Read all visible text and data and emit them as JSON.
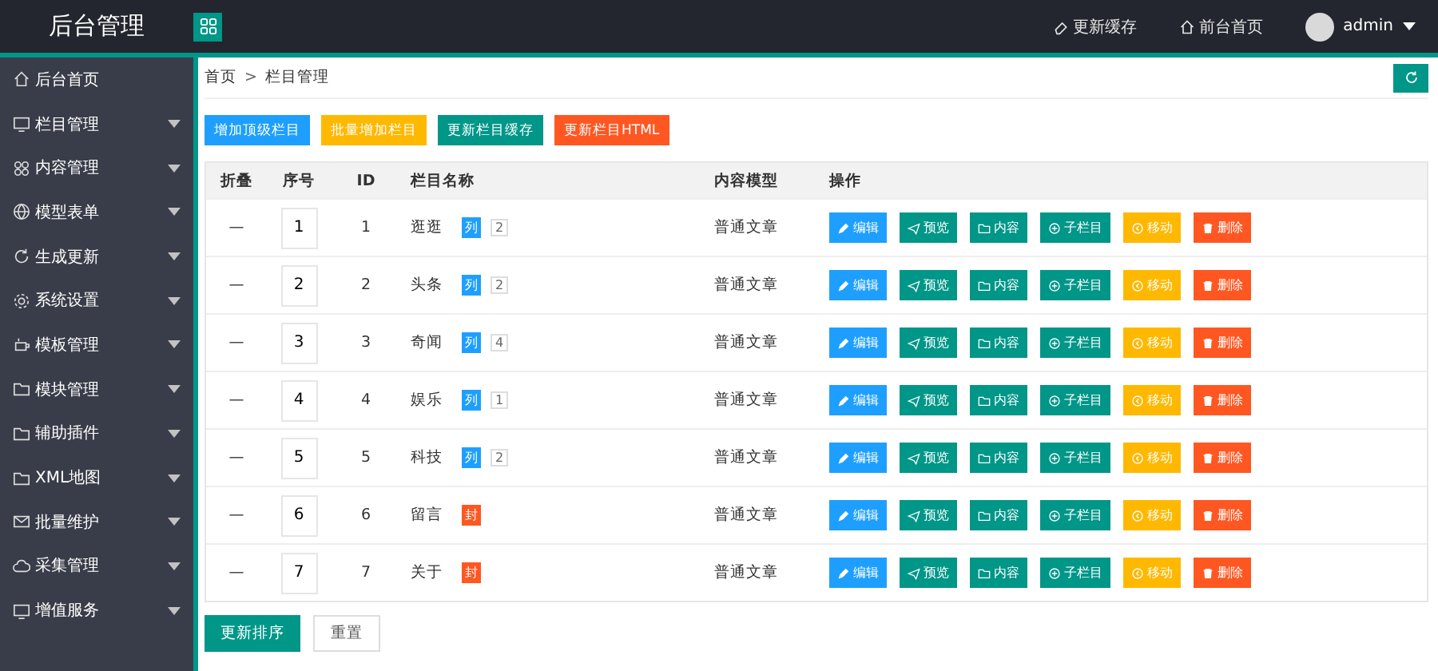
{
  "header": {
    "title": "后台管理",
    "links": [
      {
        "label": "更新缓存",
        "kind": "cache"
      },
      {
        "label": "前台首页",
        "kind": "home"
      }
    ],
    "user": "admin"
  },
  "sidebar": {
    "items": [
      {
        "label": "后台首页",
        "kind": "home",
        "submenu": false
      },
      {
        "label": "栏目管理",
        "kind": "monitor",
        "submenu": true
      },
      {
        "label": "内容管理",
        "kind": "apps",
        "submenu": true
      },
      {
        "label": "模型表单",
        "kind": "globe",
        "submenu": true
      },
      {
        "label": "生成更新",
        "kind": "refresh",
        "submenu": true
      },
      {
        "label": "系统设置",
        "kind": "gear",
        "submenu": true
      },
      {
        "label": "模板管理",
        "kind": "cup",
        "submenu": true
      },
      {
        "label": "模块管理",
        "kind": "folder",
        "submenu": true
      },
      {
        "label": "辅助插件",
        "kind": "folder",
        "submenu": true
      },
      {
        "label": "XML地图",
        "kind": "folder",
        "submenu": true
      },
      {
        "label": "批量维护",
        "kind": "mail",
        "submenu": true
      },
      {
        "label": "采集管理",
        "kind": "cloud",
        "submenu": true
      },
      {
        "label": "增值服务",
        "kind": "monitor",
        "submenu": true
      }
    ]
  },
  "breadcrumb": {
    "items": [
      "首页",
      "栏目管理"
    ],
    "separator": ">"
  },
  "toolbar": [
    {
      "label": "增加顶级栏目",
      "kind": "blue"
    },
    {
      "label": "批量增加栏目",
      "kind": "yellow"
    },
    {
      "label": "更新栏目缓存",
      "kind": "teal"
    },
    {
      "label": "更新栏目HTML",
      "kind": "red"
    }
  ],
  "table": {
    "columns": [
      "折叠",
      "序号",
      "ID",
      "栏目名称",
      "内容模型",
      "操作"
    ],
    "rows": [
      {
        "fold": "—",
        "order": "1",
        "id": "1",
        "name": "逛逛",
        "tag": {
          "text": "列",
          "color": "#1e9fff"
        },
        "count": "2",
        "model": "普通文章",
        "actions": [
          {
            "label": "编辑",
            "kind": "edit"
          },
          {
            "label": "预览",
            "kind": "preview"
          },
          {
            "label": "内容",
            "kind": "content"
          },
          {
            "label": "子栏目",
            "kind": "sub"
          },
          {
            "label": "移动",
            "kind": "move"
          },
          {
            "label": "删除",
            "kind": "delete"
          }
        ]
      },
      {
        "fold": "—",
        "order": "2",
        "id": "2",
        "name": "头条",
        "tag": {
          "text": "列",
          "color": "#1e9fff"
        },
        "count": "2",
        "model": "普通文章",
        "actions": [
          {
            "label": "编辑",
            "kind": "edit"
          },
          {
            "label": "预览",
            "kind": "preview"
          },
          {
            "label": "内容",
            "kind": "content"
          },
          {
            "label": "子栏目",
            "kind": "sub"
          },
          {
            "label": "移动",
            "kind": "move"
          },
          {
            "label": "删除",
            "kind": "delete"
          }
        ]
      },
      {
        "fold": "—",
        "order": "3",
        "id": "3",
        "name": "奇闻",
        "tag": {
          "text": "列",
          "color": "#1e9fff"
        },
        "count": "4",
        "model": "普通文章",
        "actions": [
          {
            "label": "编辑",
            "kind": "edit"
          },
          {
            "label": "预览",
            "kind": "preview"
          },
          {
            "label": "内容",
            "kind": "content"
          },
          {
            "label": "子栏目",
            "kind": "sub"
          },
          {
            "label": "移动",
            "kind": "move"
          },
          {
            "label": "删除",
            "kind": "delete"
          }
        ]
      },
      {
        "fold": "—",
        "order": "4",
        "id": "4",
        "name": "娱乐",
        "tag": {
          "text": "列",
          "color": "#1e9fff"
        },
        "count": "1",
        "model": "普通文章",
        "actions": [
          {
            "label": "编辑",
            "kind": "edit"
          },
          {
            "label": "预览",
            "kind": "preview"
          },
          {
            "label": "内容",
            "kind": "content"
          },
          {
            "label": "子栏目",
            "kind": "sub"
          },
          {
            "label": "移动",
            "kind": "move"
          },
          {
            "label": "删除",
            "kind": "delete"
          }
        ]
      },
      {
        "fold": "—",
        "order": "5",
        "id": "5",
        "name": "科技",
        "tag": {
          "text": "列",
          "color": "#1e9fff"
        },
        "count": "2",
        "model": "普通文章",
        "actions": [
          {
            "label": "编辑",
            "kind": "edit"
          },
          {
            "label": "预览",
            "kind": "preview"
          },
          {
            "label": "内容",
            "kind": "content"
          },
          {
            "label": "子栏目",
            "kind": "sub"
          },
          {
            "label": "移动",
            "kind": "move"
          },
          {
            "label": "删除",
            "kind": "delete"
          }
        ]
      },
      {
        "fold": "—",
        "order": "6",
        "id": "6",
        "name": "留言",
        "tag": {
          "text": "封",
          "color": "#ff5722"
        },
        "model": "普通文章",
        "actions": [
          {
            "label": "编辑",
            "kind": "edit"
          },
          {
            "label": "预览",
            "kind": "preview"
          },
          {
            "label": "内容",
            "kind": "content"
          },
          {
            "label": "子栏目",
            "kind": "sub"
          },
          {
            "label": "移动",
            "kind": "move"
          },
          {
            "label": "删除",
            "kind": "delete"
          }
        ]
      },
      {
        "fold": "—",
        "order": "7",
        "id": "7",
        "name": "关于",
        "tag": {
          "text": "封",
          "color": "#ff5722"
        },
        "model": "普通文章",
        "actions": [
          {
            "label": "编辑",
            "kind": "edit"
          },
          {
            "label": "预览",
            "kind": "preview"
          },
          {
            "label": "内容",
            "kind": "content"
          },
          {
            "label": "子栏目",
            "kind": "sub"
          },
          {
            "label": "移动",
            "kind": "move"
          },
          {
            "label": "删除",
            "kind": "delete"
          }
        ]
      }
    ]
  },
  "footer_buttons": [
    {
      "label": "更新排序",
      "kind": "primary"
    },
    {
      "label": "重置",
      "kind": "plain"
    }
  ]
}
